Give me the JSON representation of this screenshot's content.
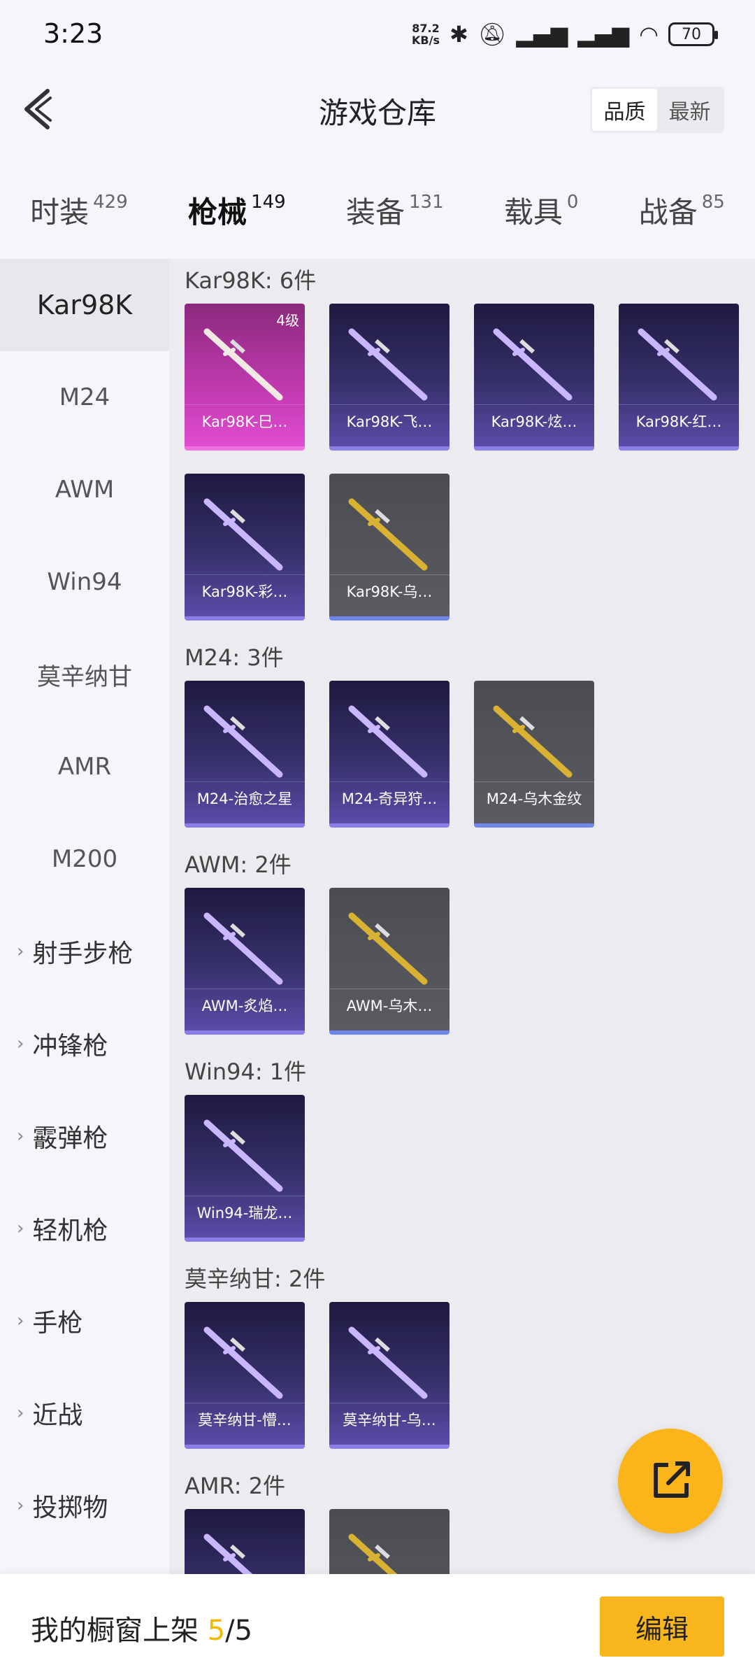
{
  "status_bar": {
    "time": "3:23",
    "net_speed_value": "87.2",
    "net_speed_unit": "KB/s",
    "battery": "70"
  },
  "header": {
    "title": "游戏仓库",
    "sort_quality": "品质",
    "sort_latest": "最新"
  },
  "tabs": [
    {
      "label": "时装",
      "count": "429"
    },
    {
      "label": "枪械",
      "count": "149"
    },
    {
      "label": "装备",
      "count": "131"
    },
    {
      "label": "载具",
      "count": "0"
    },
    {
      "label": "战备",
      "count": "85"
    }
  ],
  "sidebar": {
    "items": [
      "Kar98K",
      "M24",
      "AWM",
      "Win94",
      "莫辛纳甘",
      "AMR",
      "M200"
    ],
    "groups": [
      "射手步枪",
      "冲锋枪",
      "霰弹枪",
      "轻机枪",
      "手枪",
      "近战",
      "投掷物"
    ]
  },
  "sections": [
    {
      "title": "Kar98K: 6件",
      "cards": [
        {
          "label": "Kar98K-巳…",
          "badge": "4级",
          "style": "pink"
        },
        {
          "label": "Kar98K-飞…",
          "style": "purple"
        },
        {
          "label": "Kar98K-炫…",
          "style": "purple"
        },
        {
          "label": "Kar98K-红…",
          "style": "purple"
        },
        {
          "label": "Kar98K-彩…",
          "style": "purple"
        },
        {
          "label": "Kar98K-乌…",
          "style": "gray"
        }
      ]
    },
    {
      "title": "M24: 3件",
      "cards": [
        {
          "label": "M24-治愈之星",
          "style": "purple"
        },
        {
          "label": "M24-奇异狩…",
          "style": "purple"
        },
        {
          "label": "M24-乌木金纹",
          "style": "gray"
        }
      ]
    },
    {
      "title": "AWM: 2件",
      "cards": [
        {
          "label": "AWM-炙焰…",
          "style": "purple"
        },
        {
          "label": "AWM-乌木…",
          "style": "gray"
        }
      ]
    },
    {
      "title": "Win94: 1件",
      "cards": [
        {
          "label": "Win94-瑞龙…",
          "style": "purple"
        }
      ]
    },
    {
      "title": "莫辛纳甘: 2件",
      "cards": [
        {
          "label": "莫辛纳甘-懵…",
          "style": "purple"
        },
        {
          "label": "莫辛纳甘-乌…",
          "style": "purple"
        }
      ]
    },
    {
      "title": "AMR: 2件",
      "cards": [
        {
          "label": "",
          "style": "purple"
        },
        {
          "label": "",
          "style": "gray"
        }
      ]
    }
  ],
  "footer": {
    "text": "我的橱窗上架",
    "current": "5",
    "total": "/5",
    "edit_label": "编辑"
  },
  "colors": {
    "accent": "#f5b800",
    "fab": "#fbb419"
  }
}
